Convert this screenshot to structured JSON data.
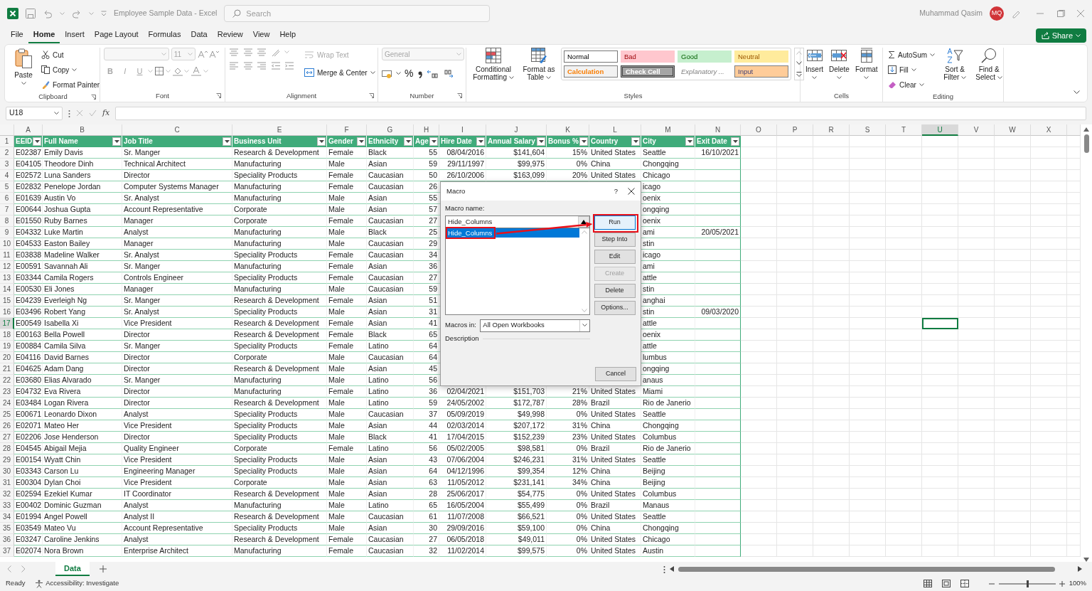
{
  "title_bar": {
    "title": "Employee Sample Data  -  Excel",
    "search": {
      "placeholder": "Search"
    },
    "user": "Muhammad Qasim",
    "avatar": "MQ"
  },
  "menu": [
    {
      "label": "File",
      "selected": false
    },
    {
      "label": "Home",
      "selected": true
    },
    {
      "label": "Insert",
      "selected": false
    },
    {
      "label": "Page Layout",
      "selected": false
    },
    {
      "label": "Formulas",
      "selected": false
    },
    {
      "label": "Data",
      "selected": false
    },
    {
      "label": "Review",
      "selected": false
    },
    {
      "label": "View",
      "selected": false
    },
    {
      "label": "Help",
      "selected": false
    }
  ],
  "share_button": "Share",
  "ribbon": {
    "clipboard": {
      "label": "Clipboard",
      "paste": "Paste",
      "cut": "Cut",
      "copy": "Copy",
      "format_painter": "Format Painter"
    },
    "font": {
      "label": "Font",
      "size": "11",
      "styles": [
        "B",
        "I",
        "U"
      ]
    },
    "alignment": {
      "label": "Alignment",
      "wrap_text": {
        "label": "Wrap Text",
        "disabled": true
      },
      "merge": {
        "label": "Merge & Center",
        "disabled": false
      }
    },
    "number": {
      "label": "Number",
      "format": "General",
      "percent": "%"
    },
    "styles": {
      "label": "Styles",
      "conditional_formatting": "Conditional Formatting",
      "format_as_table": "Format as Table",
      "gallery": [
        {
          "label": "Normal",
          "kind": "normal"
        },
        {
          "label": "Bad",
          "kind": "bad"
        },
        {
          "label": "Good",
          "kind": "good"
        },
        {
          "label": "Neutral",
          "kind": "neutral"
        },
        {
          "label": "Calculation",
          "kind": "calculation"
        },
        {
          "label": "Check Cell",
          "kind": "check"
        },
        {
          "label": "Explanatory ...",
          "kind": "explanatory"
        },
        {
          "label": "Input",
          "kind": "input"
        }
      ]
    },
    "cells": {
      "label": "Cells",
      "buttons": [
        "Insert",
        "Delete",
        "Format"
      ]
    },
    "editing": {
      "label": "Editing",
      "autosum": "AutoSum",
      "fill": "Fill",
      "clear": "Clear",
      "sort_filter": "Sort & Filter",
      "find_select": "Find & Select"
    }
  },
  "formula_bar": {
    "name_box": "U18",
    "fx": "fx"
  },
  "sheet": {
    "columns": [
      {
        "label": "A",
        "selected": false
      },
      {
        "label": "B",
        "selected": false
      },
      {
        "label": "C",
        "selected": false
      },
      {
        "label": "E",
        "selected": false
      },
      {
        "label": "F",
        "selected": false
      },
      {
        "label": "G",
        "selected": false
      },
      {
        "label": "H",
        "selected": false
      },
      {
        "label": "I",
        "selected": false
      },
      {
        "label": "J",
        "selected": false
      },
      {
        "label": "K",
        "selected": false
      },
      {
        "label": "L",
        "selected": false
      },
      {
        "label": "M",
        "selected": false
      },
      {
        "label": "N",
        "selected": false
      },
      {
        "label": "O",
        "selected": false
      },
      {
        "label": "P",
        "selected": false
      },
      {
        "label": "R",
        "selected": false
      },
      {
        "label": "S",
        "selected": false
      },
      {
        "label": "T",
        "selected": false
      },
      {
        "label": "U",
        "selected": true
      },
      {
        "label": "V",
        "selected": false
      },
      {
        "label": "W",
        "selected": false
      },
      {
        "label": "X",
        "selected": false
      }
    ],
    "rows": [
      {
        "number": "1",
        "kind": "header",
        "selected": false,
        "cells": [
          "EEID",
          "Full Name",
          "Job Title",
          "Business Unit",
          "Gender",
          "Ethnicity",
          "Age",
          "Hire Date",
          "Annual Salary",
          "Bonus %",
          "Country",
          "City",
          "Exit Date"
        ]
      },
      {
        "number": "2",
        "kind": "data",
        "selected": false,
        "cells": [
          "E02387",
          "Emily Davis",
          "Sr. Manger",
          "Research & Development",
          "Female",
          "Black",
          "55",
          "08/04/2016",
          "$141,604",
          "15%",
          "United States",
          "Seattle",
          "16/10/2021"
        ]
      },
      {
        "number": "3",
        "kind": "data",
        "selected": false,
        "cells": [
          "E04105",
          "Theodore Dinh",
          "Technical Architect",
          "Manufacturing",
          "Male",
          "Asian",
          "59",
          "29/11/1997",
          "$99,975",
          "0%",
          "China",
          "Chongqing",
          null
        ]
      },
      {
        "number": "4",
        "kind": "data",
        "selected": false,
        "cells": [
          "E02572",
          "Luna Sanders",
          "Director",
          "Speciality Products",
          "Female",
          "Caucasian",
          "50",
          "26/10/2006",
          "$163,099",
          "20%",
          "United States",
          "Chicago",
          null
        ]
      },
      {
        "number": "5",
        "kind": "data",
        "selected": false,
        "cells": [
          "E02832",
          "Penelope Jordan",
          "Computer Systems Manager",
          "Manufacturing",
          "Female",
          "Caucasian",
          "26",
          null,
          null,
          null,
          null,
          "icago",
          null
        ]
      },
      {
        "number": "6",
        "kind": "data",
        "selected": false,
        "cells": [
          "E01639",
          "Austin Vo",
          "Sr. Analyst",
          "Manufacturing",
          "Male",
          "Asian",
          "55",
          null,
          null,
          null,
          null,
          "oenix",
          null
        ]
      },
      {
        "number": "7",
        "kind": "data",
        "selected": false,
        "cells": [
          "E00644",
          "Joshua Gupta",
          "Account Representative",
          "Corporate",
          "Male",
          "Asian",
          "57",
          null,
          null,
          null,
          null,
          "ongqing",
          null
        ]
      },
      {
        "number": "8",
        "kind": "data",
        "selected": false,
        "cells": [
          "E01550",
          "Ruby Barnes",
          "Manager",
          "Corporate",
          "Female",
          "Caucasian",
          "27",
          null,
          null,
          null,
          null,
          "oenix",
          null
        ]
      },
      {
        "number": "9",
        "kind": "data",
        "selected": false,
        "cells": [
          "E04332",
          "Luke Martin",
          "Analyst",
          "Manufacturing",
          "Male",
          "Black",
          "25",
          null,
          null,
          null,
          null,
          "ami",
          "20/05/2021"
        ]
      },
      {
        "number": "10",
        "kind": "data",
        "selected": false,
        "cells": [
          "E04533",
          "Easton Bailey",
          "Manager",
          "Manufacturing",
          "Male",
          "Caucasian",
          "29",
          null,
          null,
          null,
          null,
          "stin",
          null
        ]
      },
      {
        "number": "11",
        "kind": "data",
        "selected": false,
        "cells": [
          "E03838",
          "Madeline Walker",
          "Sr. Analyst",
          "Speciality Products",
          "Female",
          "Caucasian",
          "34",
          null,
          null,
          null,
          null,
          "icago",
          null
        ]
      },
      {
        "number": "12",
        "kind": "data",
        "selected": false,
        "cells": [
          "E00591",
          "Savannah Ali",
          "Sr. Manger",
          "Manufacturing",
          "Female",
          "Asian",
          "36",
          null,
          null,
          null,
          null,
          "ami",
          null
        ]
      },
      {
        "number": "13",
        "kind": "data",
        "selected": false,
        "cells": [
          "E03344",
          "Camila Rogers",
          "Controls Engineer",
          "Speciality Products",
          "Female",
          "Caucasian",
          "27",
          null,
          null,
          null,
          null,
          "attle",
          null
        ]
      },
      {
        "number": "14",
        "kind": "data",
        "selected": false,
        "cells": [
          "E00530",
          "Eli Jones",
          "Manager",
          "Manufacturing",
          "Male",
          "Caucasian",
          "59",
          null,
          null,
          null,
          null,
          "stin",
          null
        ]
      },
      {
        "number": "15",
        "kind": "data",
        "selected": false,
        "cells": [
          "E04239",
          "Everleigh Ng",
          "Sr. Manger",
          "Research & Development",
          "Female",
          "Asian",
          "51",
          null,
          null,
          null,
          null,
          "anghai",
          null
        ]
      },
      {
        "number": "16",
        "kind": "data",
        "selected": false,
        "cells": [
          "E03496",
          "Robert Yang",
          "Sr. Analyst",
          "Speciality Products",
          "Male",
          "Asian",
          "31",
          null,
          null,
          null,
          null,
          "stin",
          "09/03/2020"
        ]
      },
      {
        "number": "17",
        "kind": "data",
        "selected": true,
        "cells": [
          "E00549",
          "Isabella Xi",
          "Vice President",
          "Research & Development",
          "Female",
          "Asian",
          "41",
          null,
          null,
          null,
          null,
          "attle",
          null
        ]
      },
      {
        "number": "18",
        "kind": "data",
        "selected": false,
        "cells": [
          "E00163",
          "Bella Powell",
          "Director",
          "Research & Development",
          "Female",
          "Black",
          "65",
          null,
          null,
          null,
          null,
          "oenix",
          null
        ]
      },
      {
        "number": "19",
        "kind": "data",
        "selected": false,
        "cells": [
          "E00884",
          "Camila Silva",
          "Sr. Manger",
          "Speciality Products",
          "Female",
          "Latino",
          "64",
          null,
          null,
          null,
          null,
          "attle",
          null
        ]
      },
      {
        "number": "20",
        "kind": "data",
        "selected": false,
        "cells": [
          "E04116",
          "David Barnes",
          "Director",
          "Corporate",
          "Male",
          "Caucasian",
          "64",
          null,
          null,
          null,
          null,
          "lumbus",
          null
        ]
      },
      {
        "number": "21",
        "kind": "data",
        "selected": false,
        "cells": [
          "E04625",
          "Adam Dang",
          "Director",
          "Research & Development",
          "Male",
          "Asian",
          "45",
          null,
          null,
          null,
          null,
          "ongqing",
          null
        ]
      },
      {
        "number": "22",
        "kind": "data",
        "selected": false,
        "cells": [
          "E03680",
          "Elias Alvarado",
          "Sr. Manger",
          "Manufacturing",
          "Male",
          "Latino",
          "56",
          null,
          null,
          null,
          null,
          "anaus",
          null
        ]
      },
      {
        "number": "23",
        "kind": "data",
        "selected": false,
        "cells": [
          "E04732",
          "Eva Rivera",
          "Director",
          "Manufacturing",
          "Female",
          "Latino",
          "36",
          "02/04/2021",
          "$151,703",
          "21%",
          "United States",
          "Miami",
          null
        ]
      },
      {
        "number": "24",
        "kind": "data",
        "selected": false,
        "cells": [
          "E03484",
          "Logan Rivera",
          "Director",
          "Research & Development",
          "Male",
          "Latino",
          "59",
          "24/05/2002",
          "$172,787",
          "28%",
          "Brazil",
          "Rio de Janerio",
          null
        ]
      },
      {
        "number": "25",
        "kind": "data",
        "selected": false,
        "cells": [
          "E00671",
          "Leonardo Dixon",
          "Analyst",
          "Speciality Products",
          "Male",
          "Caucasian",
          "37",
          "05/09/2019",
          "$49,998",
          "0%",
          "United States",
          "Seattle",
          null
        ]
      },
      {
        "number": "26",
        "kind": "data",
        "selected": false,
        "cells": [
          "E02071",
          "Mateo Her",
          "Vice President",
          "Speciality Products",
          "Male",
          "Asian",
          "44",
          "02/03/2014",
          "$207,172",
          "31%",
          "China",
          "Chongqing",
          null
        ]
      },
      {
        "number": "27",
        "kind": "data",
        "selected": false,
        "cells": [
          "E02206",
          "Jose Henderson",
          "Director",
          "Speciality Products",
          "Male",
          "Black",
          "41",
          "17/04/2015",
          "$152,239",
          "23%",
          "United States",
          "Columbus",
          null
        ]
      },
      {
        "number": "28",
        "kind": "data",
        "selected": false,
        "cells": [
          "E04545",
          "Abigail Mejia",
          "Quality Engineer",
          "Corporate",
          "Female",
          "Latino",
          "56",
          "05/02/2005",
          "$98,581",
          "0%",
          "Brazil",
          "Rio de Janerio",
          null
        ]
      },
      {
        "number": "29",
        "kind": "data",
        "selected": false,
        "cells": [
          "E00154",
          "Wyatt Chin",
          "Vice President",
          "Speciality Products",
          "Male",
          "Asian",
          "43",
          "07/06/2004",
          "$246,231",
          "31%",
          "United States",
          "Seattle",
          null
        ]
      },
      {
        "number": "30",
        "kind": "data",
        "selected": false,
        "cells": [
          "E03343",
          "Carson Lu",
          "Engineering Manager",
          "Speciality Products",
          "Male",
          "Asian",
          "64",
          "04/12/1996",
          "$99,354",
          "12%",
          "China",
          "Beijing",
          null
        ]
      },
      {
        "number": "31",
        "kind": "data",
        "selected": false,
        "cells": [
          "E00304",
          "Dylan Choi",
          "Vice President",
          "Corporate",
          "Male",
          "Asian",
          "63",
          "11/05/2012",
          "$231,141",
          "34%",
          "China",
          "Beijing",
          null
        ]
      },
      {
        "number": "32",
        "kind": "data",
        "selected": false,
        "cells": [
          "E02594",
          "Ezekiel Kumar",
          "IT Coordinator",
          "Research & Development",
          "Male",
          "Asian",
          "28",
          "25/06/2017",
          "$54,775",
          "0%",
          "United States",
          "Columbus",
          null
        ]
      },
      {
        "number": "33",
        "kind": "data",
        "selected": false,
        "cells": [
          "E00402",
          "Dominic Guzman",
          "Analyst",
          "Manufacturing",
          "Male",
          "Latino",
          "65",
          "16/05/2004",
          "$55,499",
          "0%",
          "Brazil",
          "Manaus",
          null
        ]
      },
      {
        "number": "34",
        "kind": "data",
        "selected": false,
        "cells": [
          "E01994",
          "Angel Powell",
          "Analyst II",
          "Research & Development",
          "Male",
          "Caucasian",
          "61",
          "11/07/2008",
          "$66,521",
          "0%",
          "United States",
          "Seattle",
          null
        ]
      },
      {
        "number": "35",
        "kind": "data",
        "selected": false,
        "cells": [
          "E03549",
          "Mateo Vu",
          "Account Representative",
          "Speciality Products",
          "Male",
          "Asian",
          "30",
          "29/09/2016",
          "$59,100",
          "0%",
          "China",
          "Chongqing",
          null
        ]
      },
      {
        "number": "36",
        "kind": "data",
        "selected": false,
        "cells": [
          "E03247",
          "Caroline Jenkins",
          "Analyst",
          "Research & Development",
          "Female",
          "Caucasian",
          "27",
          "06/05/2018",
          "$49,011",
          "0%",
          "United States",
          "Chicago",
          null
        ]
      },
      {
        "number": "37",
        "kind": "data",
        "selected": false,
        "cells": [
          "E02074",
          "Nora Brown",
          "Enterprise Architect",
          "Manufacturing",
          "Female",
          "Caucasian",
          "32",
          "11/02/2014",
          "$99,575",
          "0%",
          "United States",
          "Austin",
          null
        ]
      }
    ]
  },
  "sheet_tabs": [
    {
      "label": "Data",
      "selected": true
    }
  ],
  "status_bar": {
    "mode": "Ready",
    "accessibility": "Accessibility: Investigate",
    "zoom": "100%",
    "zoom_slider": {
      "level": 0.5
    }
  },
  "dialog": {
    "title": "Macro",
    "help": "?",
    "macro_name_label": "Macro name:",
    "macro_name": "Hide_Columns",
    "macros": [
      {
        "label": "Hide_Columns",
        "selected": true,
        "highlighted": true
      }
    ],
    "buttons": [
      {
        "label": "Run",
        "disabled": false,
        "highlighted": true
      },
      {
        "label": "Step Into",
        "disabled": false,
        "highlighted": false
      },
      {
        "label": "Edit",
        "disabled": false,
        "highlighted": false
      },
      {
        "label": "Create",
        "disabled": true,
        "highlighted": false
      },
      {
        "label": "Delete",
        "disabled": false,
        "highlighted": false
      },
      {
        "label": "Options...",
        "disabled": false,
        "highlighted": false
      }
    ],
    "macros_in_label": "Macros in:",
    "macros_in": "All Open Workbooks",
    "description_label": "Description",
    "cancel": "Cancel"
  }
}
